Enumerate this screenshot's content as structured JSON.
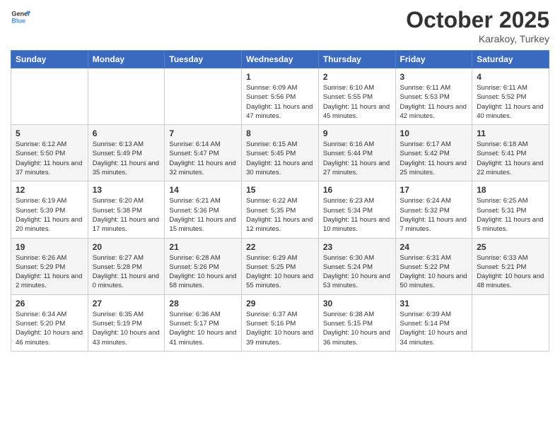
{
  "header": {
    "logo_general": "General",
    "logo_blue": "Blue",
    "month": "October 2025",
    "location": "Karakoy, Turkey"
  },
  "weekdays": [
    "Sunday",
    "Monday",
    "Tuesday",
    "Wednesday",
    "Thursday",
    "Friday",
    "Saturday"
  ],
  "weeks": [
    [
      {
        "num": "",
        "sunrise": "",
        "sunset": "",
        "daylight": ""
      },
      {
        "num": "",
        "sunrise": "",
        "sunset": "",
        "daylight": ""
      },
      {
        "num": "",
        "sunrise": "",
        "sunset": "",
        "daylight": ""
      },
      {
        "num": "1",
        "sunrise": "Sunrise: 6:09 AM",
        "sunset": "Sunset: 5:56 PM",
        "daylight": "Daylight: 11 hours and 47 minutes."
      },
      {
        "num": "2",
        "sunrise": "Sunrise: 6:10 AM",
        "sunset": "Sunset: 5:55 PM",
        "daylight": "Daylight: 11 hours and 45 minutes."
      },
      {
        "num": "3",
        "sunrise": "Sunrise: 6:11 AM",
        "sunset": "Sunset: 5:53 PM",
        "daylight": "Daylight: 11 hours and 42 minutes."
      },
      {
        "num": "4",
        "sunrise": "Sunrise: 6:11 AM",
        "sunset": "Sunset: 5:52 PM",
        "daylight": "Daylight: 11 hours and 40 minutes."
      }
    ],
    [
      {
        "num": "5",
        "sunrise": "Sunrise: 6:12 AM",
        "sunset": "Sunset: 5:50 PM",
        "daylight": "Daylight: 11 hours and 37 minutes."
      },
      {
        "num": "6",
        "sunrise": "Sunrise: 6:13 AM",
        "sunset": "Sunset: 5:49 PM",
        "daylight": "Daylight: 11 hours and 35 minutes."
      },
      {
        "num": "7",
        "sunrise": "Sunrise: 6:14 AM",
        "sunset": "Sunset: 5:47 PM",
        "daylight": "Daylight: 11 hours and 32 minutes."
      },
      {
        "num": "8",
        "sunrise": "Sunrise: 6:15 AM",
        "sunset": "Sunset: 5:45 PM",
        "daylight": "Daylight: 11 hours and 30 minutes."
      },
      {
        "num": "9",
        "sunrise": "Sunrise: 6:16 AM",
        "sunset": "Sunset: 5:44 PM",
        "daylight": "Daylight: 11 hours and 27 minutes."
      },
      {
        "num": "10",
        "sunrise": "Sunrise: 6:17 AM",
        "sunset": "Sunset: 5:42 PM",
        "daylight": "Daylight: 11 hours and 25 minutes."
      },
      {
        "num": "11",
        "sunrise": "Sunrise: 6:18 AM",
        "sunset": "Sunset: 5:41 PM",
        "daylight": "Daylight: 11 hours and 22 minutes."
      }
    ],
    [
      {
        "num": "12",
        "sunrise": "Sunrise: 6:19 AM",
        "sunset": "Sunset: 5:39 PM",
        "daylight": "Daylight: 11 hours and 20 minutes."
      },
      {
        "num": "13",
        "sunrise": "Sunrise: 6:20 AM",
        "sunset": "Sunset: 5:38 PM",
        "daylight": "Daylight: 11 hours and 17 minutes."
      },
      {
        "num": "14",
        "sunrise": "Sunrise: 6:21 AM",
        "sunset": "Sunset: 5:36 PM",
        "daylight": "Daylight: 11 hours and 15 minutes."
      },
      {
        "num": "15",
        "sunrise": "Sunrise: 6:22 AM",
        "sunset": "Sunset: 5:35 PM",
        "daylight": "Daylight: 11 hours and 12 minutes."
      },
      {
        "num": "16",
        "sunrise": "Sunrise: 6:23 AM",
        "sunset": "Sunset: 5:34 PM",
        "daylight": "Daylight: 11 hours and 10 minutes."
      },
      {
        "num": "17",
        "sunrise": "Sunrise: 6:24 AM",
        "sunset": "Sunset: 5:32 PM",
        "daylight": "Daylight: 11 hours and 7 minutes."
      },
      {
        "num": "18",
        "sunrise": "Sunrise: 6:25 AM",
        "sunset": "Sunset: 5:31 PM",
        "daylight": "Daylight: 11 hours and 5 minutes."
      }
    ],
    [
      {
        "num": "19",
        "sunrise": "Sunrise: 6:26 AM",
        "sunset": "Sunset: 5:29 PM",
        "daylight": "Daylight: 11 hours and 2 minutes."
      },
      {
        "num": "20",
        "sunrise": "Sunrise: 6:27 AM",
        "sunset": "Sunset: 5:28 PM",
        "daylight": "Daylight: 11 hours and 0 minutes."
      },
      {
        "num": "21",
        "sunrise": "Sunrise: 6:28 AM",
        "sunset": "Sunset: 5:26 PM",
        "daylight": "Daylight: 10 hours and 58 minutes."
      },
      {
        "num": "22",
        "sunrise": "Sunrise: 6:29 AM",
        "sunset": "Sunset: 5:25 PM",
        "daylight": "Daylight: 10 hours and 55 minutes."
      },
      {
        "num": "23",
        "sunrise": "Sunrise: 6:30 AM",
        "sunset": "Sunset: 5:24 PM",
        "daylight": "Daylight: 10 hours and 53 minutes."
      },
      {
        "num": "24",
        "sunrise": "Sunrise: 6:31 AM",
        "sunset": "Sunset: 5:22 PM",
        "daylight": "Daylight: 10 hours and 50 minutes."
      },
      {
        "num": "25",
        "sunrise": "Sunrise: 6:33 AM",
        "sunset": "Sunset: 5:21 PM",
        "daylight": "Daylight: 10 hours and 48 minutes."
      }
    ],
    [
      {
        "num": "26",
        "sunrise": "Sunrise: 6:34 AM",
        "sunset": "Sunset: 5:20 PM",
        "daylight": "Daylight: 10 hours and 46 minutes."
      },
      {
        "num": "27",
        "sunrise": "Sunrise: 6:35 AM",
        "sunset": "Sunset: 5:19 PM",
        "daylight": "Daylight: 10 hours and 43 minutes."
      },
      {
        "num": "28",
        "sunrise": "Sunrise: 6:36 AM",
        "sunset": "Sunset: 5:17 PM",
        "daylight": "Daylight: 10 hours and 41 minutes."
      },
      {
        "num": "29",
        "sunrise": "Sunrise: 6:37 AM",
        "sunset": "Sunset: 5:16 PM",
        "daylight": "Daylight: 10 hours and 39 minutes."
      },
      {
        "num": "30",
        "sunrise": "Sunrise: 6:38 AM",
        "sunset": "Sunset: 5:15 PM",
        "daylight": "Daylight: 10 hours and 36 minutes."
      },
      {
        "num": "31",
        "sunrise": "Sunrise: 6:39 AM",
        "sunset": "Sunset: 5:14 PM",
        "daylight": "Daylight: 10 hours and 34 minutes."
      },
      {
        "num": "",
        "sunrise": "",
        "sunset": "",
        "daylight": ""
      }
    ]
  ]
}
